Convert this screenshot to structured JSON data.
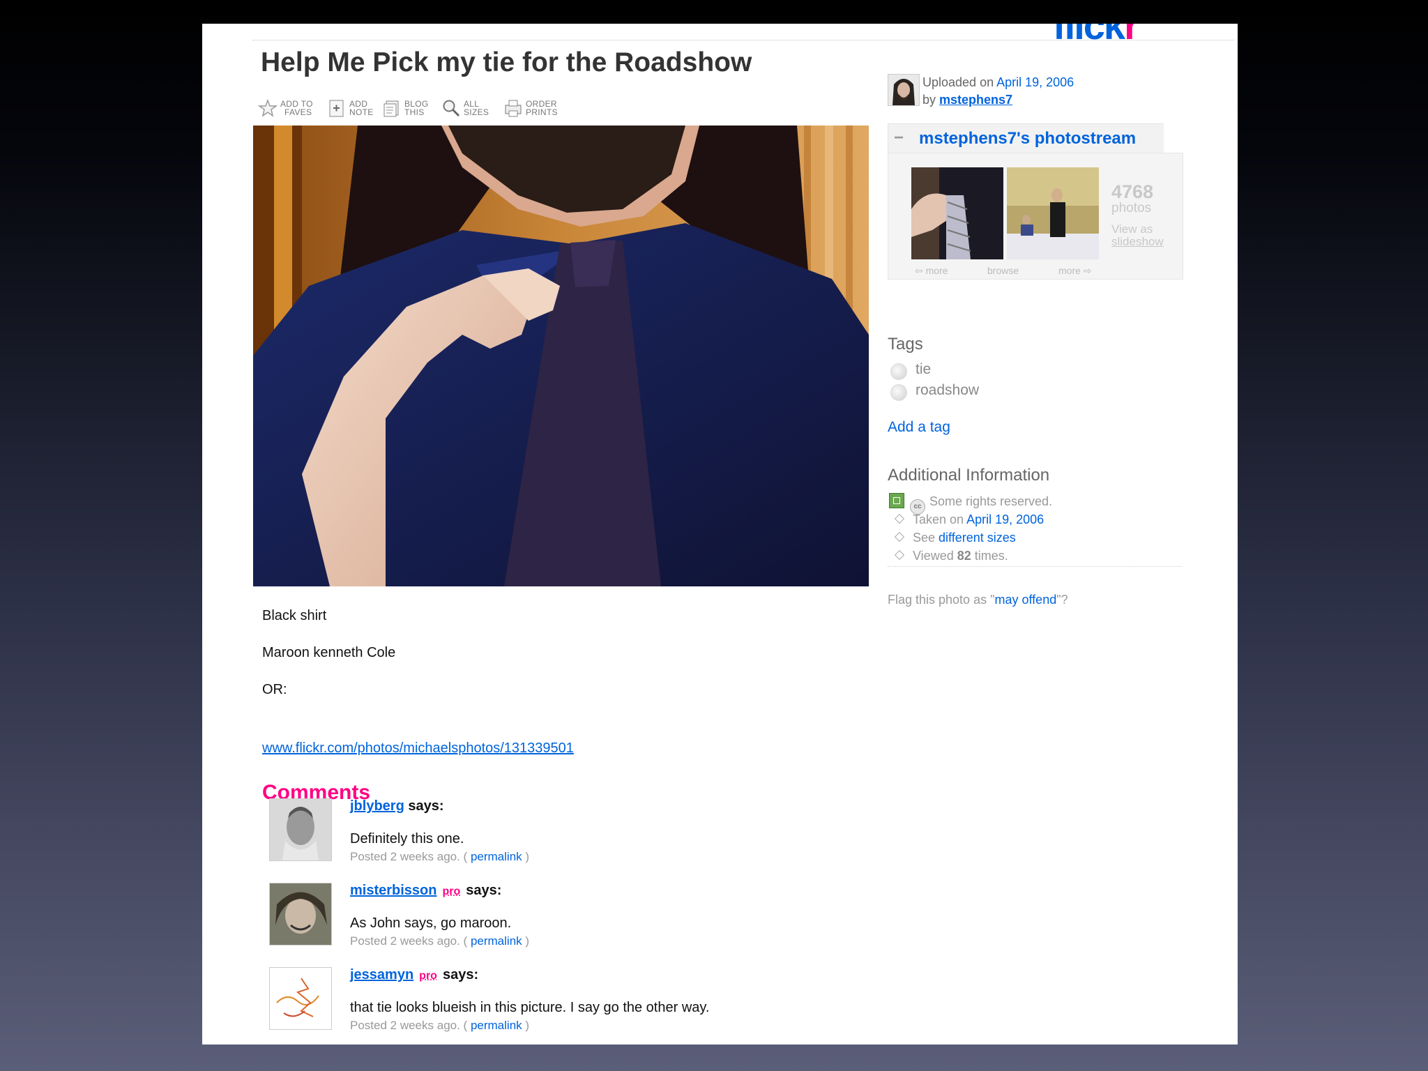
{
  "logo": {
    "main": "flick",
    "accent": "r"
  },
  "title": "Help Me Pick my tie for the Roadshow",
  "toolbar": [
    {
      "icon": "star-icon",
      "line1": "ADD TO",
      "line2": "FAVES"
    },
    {
      "icon": "add-note-icon",
      "line1": "ADD",
      "line2": "NOTE"
    },
    {
      "icon": "blog-icon",
      "line1": "BLOG",
      "line2": "THIS"
    },
    {
      "icon": "magnifier-icon",
      "line1": "ALL",
      "line2": "SIZES"
    },
    {
      "icon": "prints-icon",
      "line1": "ORDER",
      "line2": "PRINTS"
    }
  ],
  "description": {
    "line1": "Black shirt",
    "line2": "Maroon kenneth Cole",
    "line3": "OR:",
    "url": "www.flickr.com/photos/michaelsphotos/131339501"
  },
  "comments": {
    "heading": "Comments",
    "items": [
      {
        "user": "jblyberg",
        "pro": "",
        "says": "says:",
        "text": "Definitely this one.",
        "posted": "Posted 2 weeks ago. (",
        "permalink": "permalink",
        "close": ")"
      },
      {
        "user": "misterbisson",
        "pro": "pro",
        "says": "says:",
        "text": "As John says, go maroon.",
        "posted": "Posted 2 weeks ago. (",
        "permalink": "permalink",
        "close": ")"
      },
      {
        "user": "jessamyn",
        "pro": "pro",
        "says": "says:",
        "text": "that tie looks blueish in this picture. I say go the other way.",
        "posted": "Posted 2 weeks ago. (",
        "permalink": "permalink",
        "close": ")"
      }
    ]
  },
  "sidebar": {
    "uploaded_prefix": "Uploaded on",
    "uploaded_date": "April 19, 2006",
    "by": "by",
    "user": "mstephens7",
    "photostream": {
      "minus": "−",
      "title": "mstephens7's photostream",
      "count": "4768",
      "photos": "photos",
      "view_as": "View as",
      "slideshow": "slideshow",
      "nav_prev": "⇦ more",
      "nav_browse": "browse",
      "nav_next": "more ⇨"
    },
    "tags_heading": "Tags",
    "tags": [
      "tie",
      "roadshow"
    ],
    "add_tag": "Add a tag",
    "info_heading": "Additional Information",
    "rights": "Some rights reserved.",
    "taken_prefix": "Taken on",
    "taken_date": "April 19, 2006",
    "see": "See",
    "sizes_link": "different sizes",
    "viewed_prefix": "Viewed",
    "viewed_count": "82",
    "viewed_suffix": "times.",
    "flag_prefix": "Flag this photo as \"",
    "flag_link": "may offend",
    "flag_suffix": "\"?"
  },
  "colors": {
    "link": "#0063dc",
    "accent": "#ff0084",
    "title": "#333333"
  }
}
